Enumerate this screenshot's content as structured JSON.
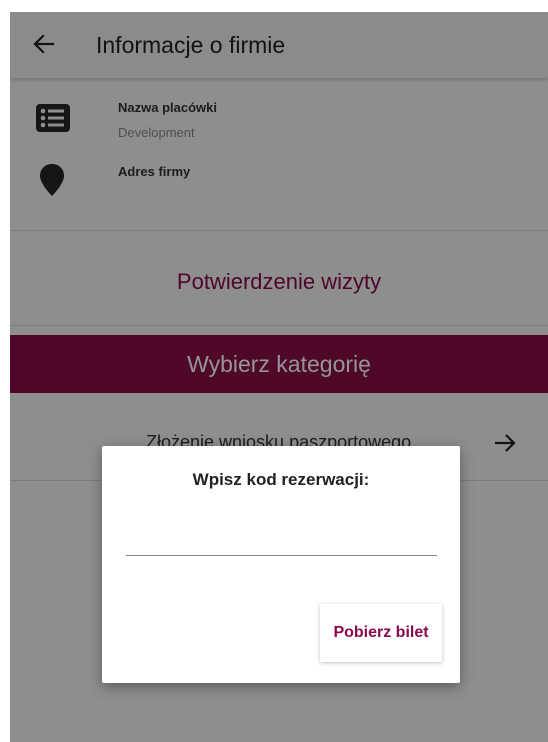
{
  "appbar": {
    "title": "Informacje o firmie",
    "back_icon": "arrow-left-icon"
  },
  "info": {
    "branch_label": "Nazwa placówki",
    "branch_value": "Development",
    "branch_icon": "list-icon",
    "address_label": "Adres firmy",
    "address_icon": "location-pin-icon"
  },
  "confirm": {
    "label": "Potwierdzenie wizyty"
  },
  "category": {
    "label": "Wybierz kategorię"
  },
  "service": {
    "label": "Złożenie wniosku paszportowego",
    "arrow_icon": "arrow-right-icon"
  },
  "dialog": {
    "title": "Wpisz kod rezerwacji:",
    "input_value": "",
    "input_placeholder": "",
    "button_label": "Pobierz bilet"
  },
  "colors": {
    "accent": "#8b0a4c",
    "banner": "#8a0e49",
    "scrim": "rgba(0,0,0,0.42)"
  }
}
